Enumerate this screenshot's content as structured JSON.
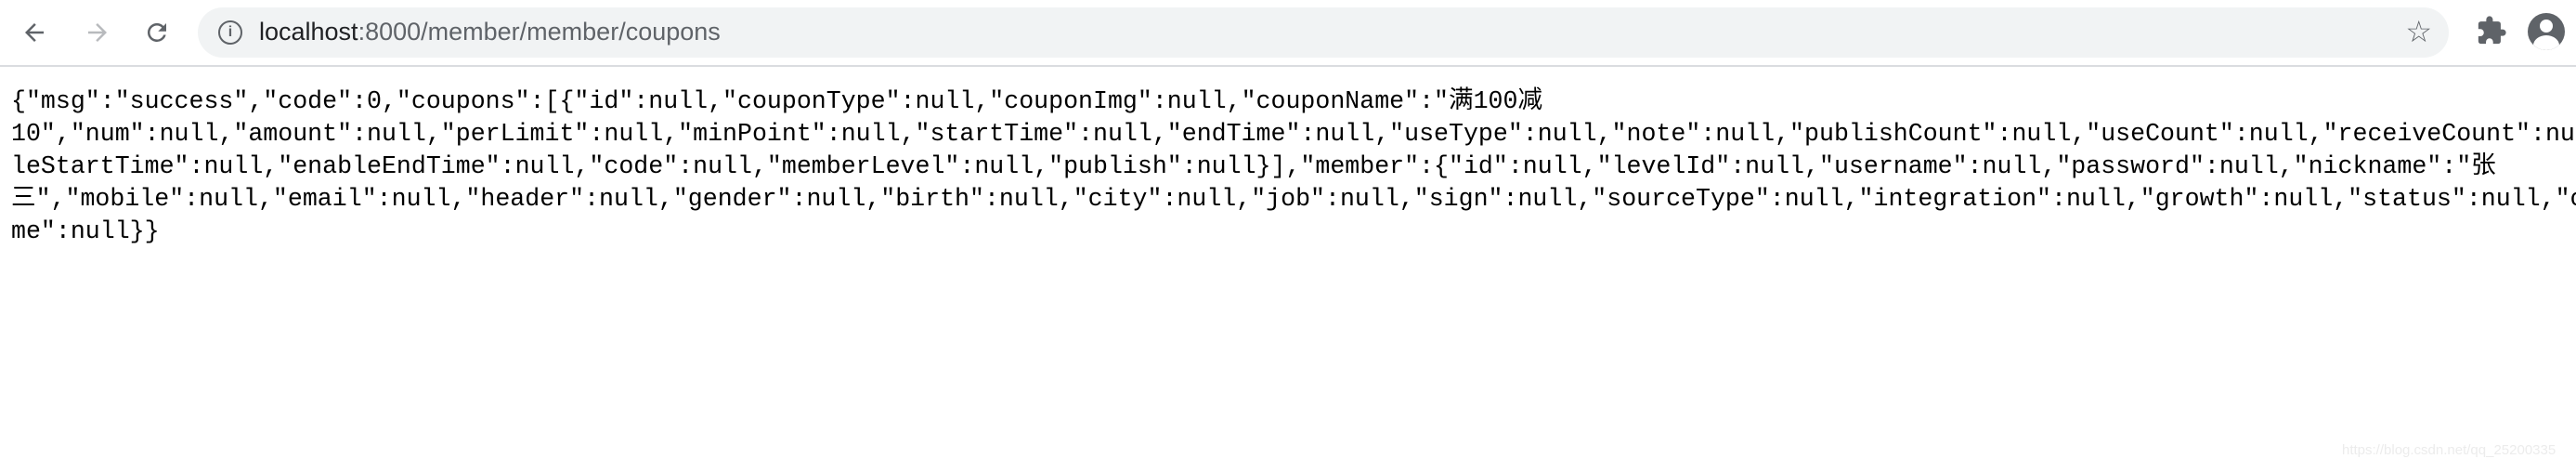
{
  "browser": {
    "url_host": "localhost",
    "url_path": ":8000/member/member/coupons",
    "icons": [
      "back-arrow-icon",
      "forward-arrow-icon",
      "reload-icon",
      "info-icon",
      "star-icon",
      "puzzle-icon",
      "profile-icon"
    ]
  },
  "body_lines": [
    "{\"msg\":\"success\",\"code\":0,\"coupons\":[{\"id\":null,\"couponType\":null,\"couponImg\":null,\"couponName\":\"满100减",
    "10\",\"num\":null,\"amount\":null,\"perLimit\":null,\"minPoint\":null,\"startTime\":null,\"endTime\":null,\"useType\":null,\"note\":null,\"publishCount\":null,\"useCount\":null,\"receiveCount\":null,\"",
    "leStartTime\":null,\"enableEndTime\":null,\"code\":null,\"memberLevel\":null,\"publish\":null}],\"member\":{\"id\":null,\"levelId\":null,\"username\":null,\"password\":null,\"nickname\":\"张",
    "三\",\"mobile\":null,\"email\":null,\"header\":null,\"gender\":null,\"birth\":null,\"city\":null,\"job\":null,\"sign\":null,\"sourceType\":null,\"integration\":null,\"growth\":null,\"status\":null,\"creat",
    "me\":null}}"
  ],
  "watermark": "https://blog.csdn.net/qq_25200335"
}
